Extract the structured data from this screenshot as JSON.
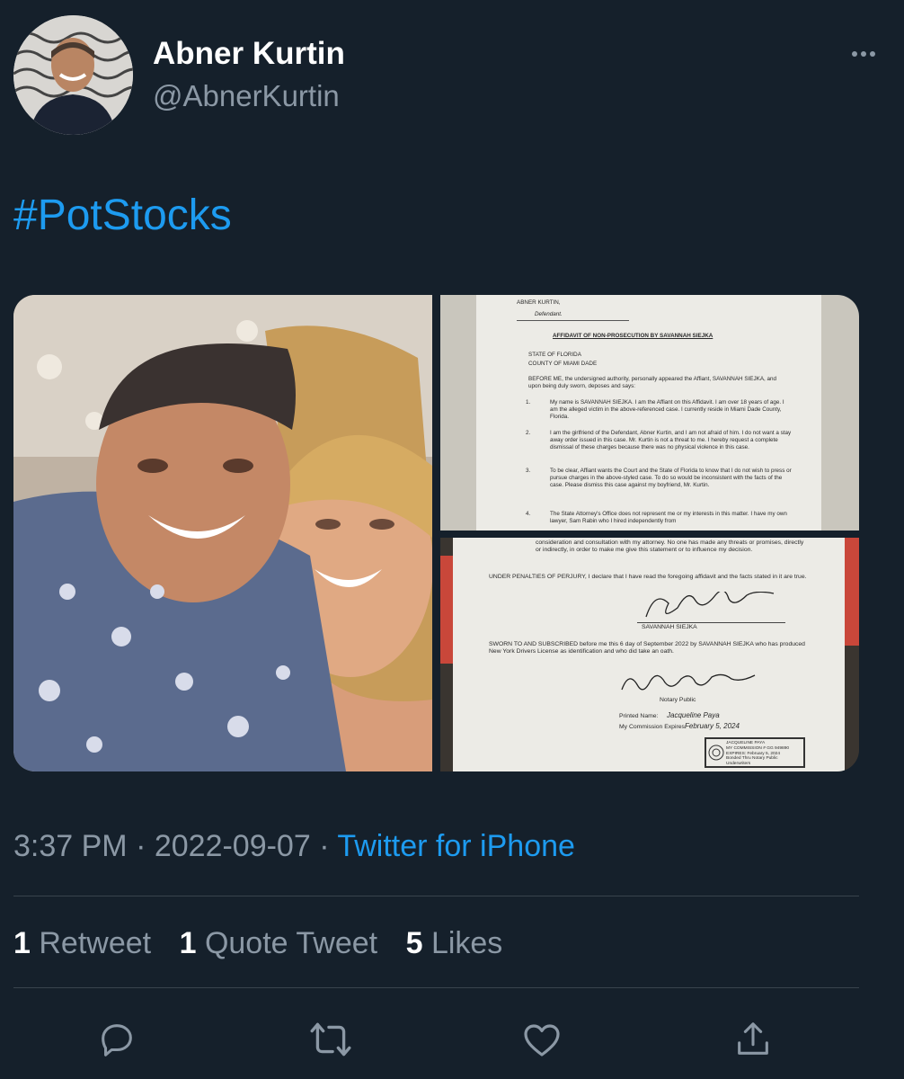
{
  "tweet": {
    "author_name": "Abner Kurtin",
    "author_handle": "@AbnerKurtin",
    "text": "#PotStocks",
    "timestamp": "3:37 PM · 2022-09-07 · ",
    "source": "Twitter for iPhone"
  },
  "stats": {
    "retweets_count": "1",
    "retweets_label": "Retweet",
    "quotes_count": "1",
    "quotes_label": "Quote Tweet",
    "likes_count": "5",
    "likes_label": "Likes"
  },
  "affidavit_page1": {
    "caption_name": "ABNER KURTIN,",
    "caption_role": "Defendant.",
    "title": "AFFIDAVIT OF NON-PROSECUTION BY SAVANNAH SIEJKA",
    "state": "STATE OF FLORIDA",
    "county": "COUNTY OF MIAMI DADE",
    "intro": "BEFORE ME, the undersigned authority, personally appeared the Affiant, SAVANNAH SIEJKA, and upon being duly sworn, deposes and says:",
    "items": [
      "My name is SAVANNAH SIEJKA. I am the Affiant on this Affidavit. I am over 18 years of age. I am the alleged victim in the above-referenced case. I currently reside in Miami Dade County, Florida.",
      "I am the girlfriend of the Defendant, Abner Kurtin, and I am not afraid of him. I do not want a stay away order issued in this case. Mr. Kurtin is not a threat to me. I hereby request a complete dismissal of these charges because there was no physical violence in this case.",
      "To be clear, Affiant wants the Court and the State of Florida to know that I do not wish to press or pursue charges in the above-styled case. To do so would be inconsistent with the facts of the case. Please dismiss this case against my boyfriend, Mr. Kurtin.",
      "The State Attorney's Office does not represent me or my interests in this matter. I have my own lawyer, Sam Rabin who I hired independently from"
    ]
  },
  "affidavit_page2": {
    "continued": "consideration and consultation with my attorney. No one has made any threats or promises, directly or indirectly, in order to make me give this statement or to influence my decision.",
    "perjury": "UNDER PENALTIES OF PERJURY, I declare that I have read the foregoing affidavit and the facts stated in it are true.",
    "signer": "SAVANNAH SIEJKA",
    "sworn": "SWORN TO AND SUBSCRIBED before me this 6 day of September 2022 by SAVANNAH SIEJKA who has produced New York Drivers License as identification and who did take an oath.",
    "notary_role": "Notary Public",
    "printed_name_label": "Printed Name:",
    "printed_name": "Jacqueline Paya",
    "commission_label": "My Commission Expires:",
    "commission_date": "February 5, 2024",
    "seal_lines": [
      "JACQUELINE PAYA",
      "MY COMMISSION # GG 949890",
      "EXPIRES: February 5, 2024",
      "Bonded Thru Notary Public Underwriters"
    ]
  },
  "icons": [
    "more-icon",
    "reply-icon",
    "retweet-icon",
    "like-icon",
    "share-icon"
  ],
  "colors": {
    "background": "#15202b",
    "accent": "#1d9bf0",
    "secondary_text": "#8b98a5",
    "divider": "#38444d"
  }
}
